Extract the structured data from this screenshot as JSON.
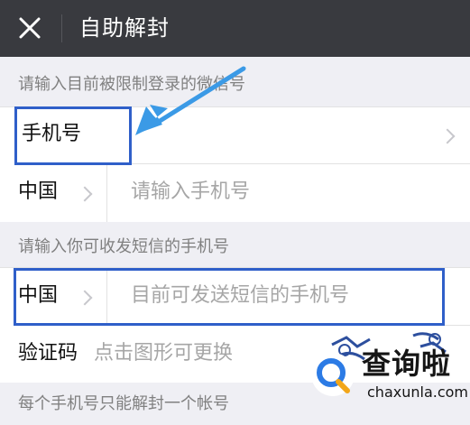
{
  "header": {
    "title": "自助解封"
  },
  "section1": {
    "label": "请输入目前被限制登录的微信号",
    "account_field": {
      "label": "手机号"
    },
    "phone_row": {
      "country": "中国",
      "placeholder": "请输入手机号"
    }
  },
  "section2": {
    "label": "请输入你可收发短信的手机号",
    "sms_row": {
      "country": "中国",
      "placeholder": "目前可发送短信的手机号"
    },
    "code_row": {
      "label": "验证码",
      "placeholder": "点击图形可更换"
    },
    "footnote": "每个手机号只能解封一个帐号"
  },
  "watermark": {
    "main": "查询啦",
    "sub": "chaxunla.com"
  },
  "colors": {
    "titlebar": "#393a3f",
    "background": "#efeff4",
    "highlight": "#2f5fc9",
    "arrow": "#3b9ae6"
  },
  "icons": [
    "close-icon",
    "chevron-right-icon",
    "annotation-arrow-icon",
    "captcha-image",
    "watermark-logo-icon"
  ]
}
